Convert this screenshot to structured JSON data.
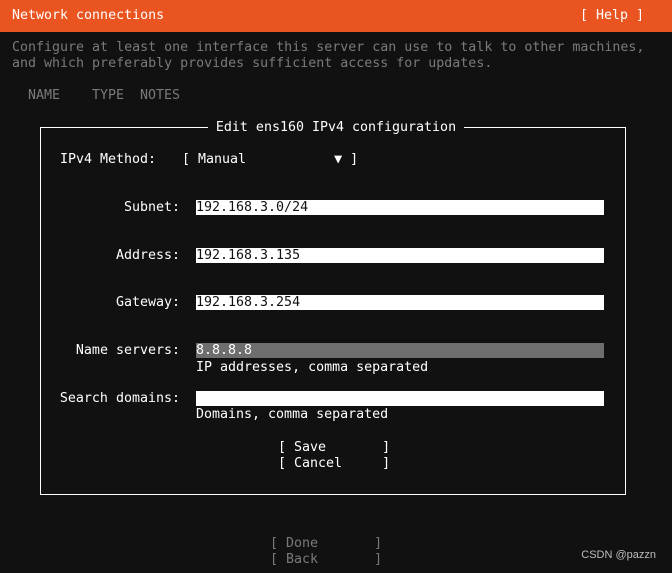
{
  "header": {
    "title": "Network connections",
    "help_label": "[ Help ]",
    "accent": "#e95420"
  },
  "intro": [
    "Configure at least one interface this server can use to talk to other machines,",
    "and which preferably provides sufficient access for updates."
  ],
  "table": {
    "columns": [
      "NAME",
      "TYPE",
      "NOTES"
    ]
  },
  "dialog": {
    "title": "Edit ens160 IPv4 configuration",
    "method": {
      "label": "IPv4 Method:",
      "value": "[ Manual           ▼ ]"
    },
    "subnet": {
      "label": "Subnet:",
      "value": "192.168.3.0/24"
    },
    "address": {
      "label": "Address:",
      "value": "192.168.3.135"
    },
    "gateway": {
      "label": "Gateway:",
      "value": "192.168.3.254"
    },
    "name_servers": {
      "label": "Name servers:",
      "value": "8.8.8.8",
      "hint": "IP addresses, comma separated"
    },
    "search_domains": {
      "label": "Search domains:",
      "value": "",
      "hint": "Domains, comma separated"
    },
    "save_label": "[ Save       ]",
    "cancel_label": "[ Cancel     ]"
  },
  "footer": {
    "done_label": "[ Done       ]",
    "back_label": "[ Back       ]"
  },
  "watermark": "CSDN @pazzn"
}
